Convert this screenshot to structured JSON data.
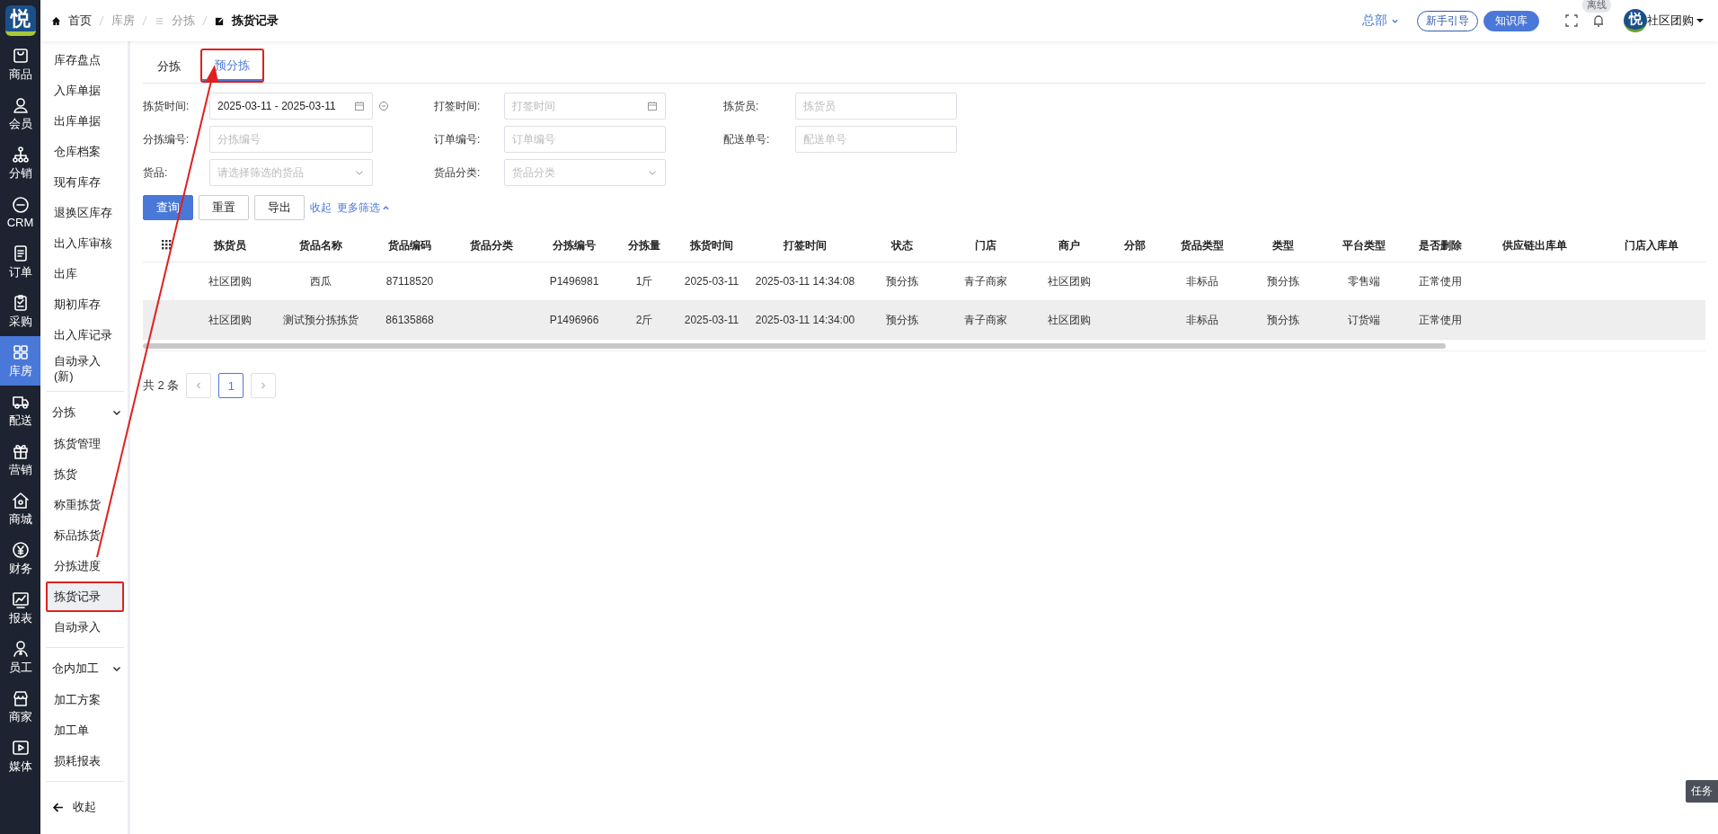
{
  "logo": {
    "text": "悦"
  },
  "breadcrumb": [
    {
      "label": "首页",
      "kind": "home",
      "current": false
    },
    {
      "label": "库房",
      "kind": "plain",
      "current": false
    },
    {
      "label": "分拣",
      "kind": "list",
      "current": false
    },
    {
      "label": "拣货记录",
      "kind": "edit",
      "current": true
    }
  ],
  "header": {
    "branch": "总部",
    "guide_button": "新手引导",
    "kb_button": "知识库",
    "status_badge": "离线",
    "avatar_text": "悦",
    "user": "社区团购"
  },
  "nav_rail": [
    {
      "label": "商品",
      "selected": false
    },
    {
      "label": "会员",
      "selected": false
    },
    {
      "label": "分销",
      "selected": false
    },
    {
      "label": "CRM",
      "selected": false
    },
    {
      "label": "订单",
      "selected": false
    },
    {
      "label": "采购",
      "selected": false
    },
    {
      "label": "库房",
      "selected": true
    },
    {
      "label": "配送",
      "selected": false
    },
    {
      "label": "营销",
      "selected": false
    },
    {
      "label": "商城",
      "selected": false
    },
    {
      "label": "财务",
      "selected": false
    },
    {
      "label": "报表",
      "selected": false
    },
    {
      "label": "员工",
      "selected": false
    },
    {
      "label": "商家",
      "selected": false
    },
    {
      "label": "媒体",
      "selected": false
    }
  ],
  "sidebar": [
    {
      "kind": "item",
      "label": "库存盘点",
      "selected": false,
      "highlighted": false
    },
    {
      "kind": "item",
      "label": "入库单据",
      "selected": false,
      "highlighted": false
    },
    {
      "kind": "item",
      "label": "出库单据",
      "selected": false,
      "highlighted": false
    },
    {
      "kind": "item",
      "label": "仓库档案",
      "selected": false,
      "highlighted": false
    },
    {
      "kind": "item",
      "label": "现有库存",
      "selected": false,
      "highlighted": false
    },
    {
      "kind": "item",
      "label": "退换区库存",
      "selected": false,
      "highlighted": false
    },
    {
      "kind": "item",
      "label": "出入库审核",
      "selected": false,
      "highlighted": false
    },
    {
      "kind": "item",
      "label": "出库",
      "selected": false,
      "highlighted": false
    },
    {
      "kind": "item",
      "label": "期初库存",
      "selected": false,
      "highlighted": false
    },
    {
      "kind": "item",
      "label": "出入库记录",
      "selected": false,
      "highlighted": false
    },
    {
      "kind": "item",
      "label": "自动录入(新)",
      "selected": false,
      "highlighted": false
    },
    {
      "kind": "divider"
    },
    {
      "kind": "group",
      "label": "分拣",
      "expanded": true
    },
    {
      "kind": "item",
      "label": "拣货管理",
      "selected": false,
      "highlighted": false
    },
    {
      "kind": "item",
      "label": "拣货",
      "selected": false,
      "highlighted": false
    },
    {
      "kind": "item",
      "label": "称重拣货",
      "selected": false,
      "highlighted": false
    },
    {
      "kind": "item",
      "label": "标品拣货",
      "selected": false,
      "highlighted": false
    },
    {
      "kind": "item",
      "label": "分拣进度",
      "selected": false,
      "highlighted": false
    },
    {
      "kind": "item",
      "label": "拣货记录",
      "selected": true,
      "highlighted": true
    },
    {
      "kind": "item",
      "label": "自动录入",
      "selected": false,
      "highlighted": false
    },
    {
      "kind": "divider"
    },
    {
      "kind": "group",
      "label": "仓内加工",
      "expanded": true
    },
    {
      "kind": "item",
      "label": "加工方案",
      "selected": false,
      "highlighted": false
    },
    {
      "kind": "item",
      "label": "加工单",
      "selected": false,
      "highlighted": false
    },
    {
      "kind": "item",
      "label": "损耗报表",
      "selected": false,
      "highlighted": false
    },
    {
      "kind": "divider"
    }
  ],
  "collapse": "收起",
  "tabs": [
    {
      "label": "分拣",
      "selected": false,
      "highlighted": false
    },
    {
      "label": "预分拣",
      "selected": true,
      "highlighted": true
    }
  ],
  "filters": [
    {
      "label": "拣货时间:",
      "kind": "daterange",
      "value": "2025-03-11 - 2025-03-11"
    },
    {
      "label": "打签时间:",
      "kind": "date",
      "placeholder": "打签时间"
    },
    {
      "label": "拣货员:",
      "kind": "text",
      "placeholder": "拣货员"
    },
    {
      "label": "分拣编号:",
      "kind": "text",
      "placeholder": "分拣编号"
    },
    {
      "label": "订单编号:",
      "kind": "text",
      "placeholder": "订单编号"
    },
    {
      "label": "配送单号:",
      "kind": "text",
      "placeholder": "配送单号"
    },
    {
      "label": "货品:",
      "kind": "select",
      "placeholder": "请选择筛选的货品"
    },
    {
      "label": "货品分类:",
      "kind": "select",
      "placeholder": "货品分类"
    }
  ],
  "actions": {
    "buttons": [
      {
        "label": "查询",
        "primary": true
      },
      {
        "label": "重置",
        "primary": false
      },
      {
        "label": "导出",
        "primary": false
      }
    ],
    "collapse_link": "收起",
    "more_link": "更多筛选"
  },
  "table": {
    "columns": [
      "拣货员",
      "货品名称",
      "货品编码",
      "货品分类",
      "分拣编号",
      "分拣量",
      "拣货时间",
      "打签时间",
      "状态",
      "门店",
      "商户",
      "分部",
      "货品类型",
      "类型",
      "平台类型",
      "是否删除",
      "供应链出库单",
      "门店入库单"
    ],
    "rows": [
      {
        "hovered": false,
        "cells": [
          "社区团购",
          "西瓜",
          "87118520",
          null,
          "P1496981",
          "1斤",
          "2025-03-11",
          "2025-03-11 14:34:08",
          "预分拣",
          "青子商家",
          "社区团购",
          null,
          "非标品",
          "预分拣",
          "零售端",
          "正常使用",
          null,
          null
        ]
      },
      {
        "hovered": true,
        "cells": [
          "社区团购",
          "测试预分拣拣货",
          "86135868",
          null,
          "P1496966",
          "2斤",
          "2025-03-11",
          "2025-03-11 14:34:00",
          "预分拣",
          "青子商家",
          "社区团购",
          null,
          "非标品",
          "预分拣",
          "订货端",
          "正常使用",
          null,
          null
        ]
      }
    ]
  },
  "pagination": {
    "total": "共 2 条",
    "pages": [
      {
        "label": "1",
        "selected": true
      }
    ]
  },
  "task_button": "任务"
}
